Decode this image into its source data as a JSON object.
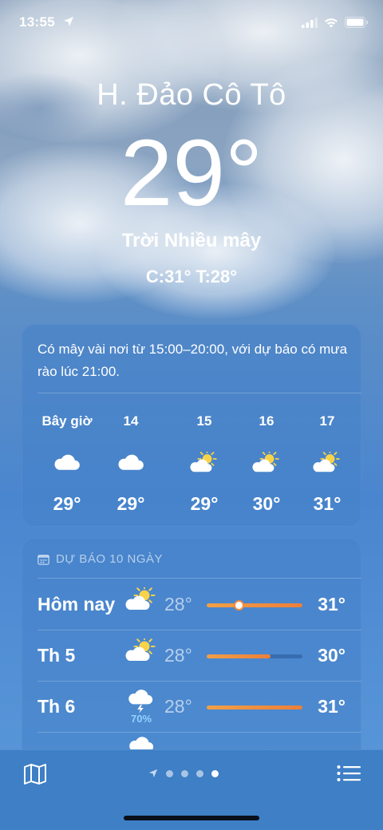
{
  "status_bar": {
    "time": "13:55"
  },
  "location": {
    "name": "H. Đảo Cô Tô",
    "temperature": "29°",
    "condition": "Trời Nhiều mây",
    "high_low": "C:31°  T:28°"
  },
  "hourly": {
    "summary": "Có mây vài nơi từ 15:00–20:00, với dự báo có mưa rào lúc 21:00.",
    "items": [
      {
        "label": "Bây giờ",
        "icon": "cloud-icon",
        "temp": "29°"
      },
      {
        "label": "14",
        "icon": "cloud-icon",
        "temp": "29°"
      },
      {
        "label": "15",
        "icon": "partly-sunny-icon",
        "temp": "29°"
      },
      {
        "label": "16",
        "icon": "partly-sunny-icon",
        "temp": "30°"
      },
      {
        "label": "17",
        "icon": "partly-sunny-icon",
        "temp": "31°"
      }
    ]
  },
  "daily": {
    "header": "DỰ BÁO 10 NGÀY",
    "range": [
      28,
      31
    ],
    "items": [
      {
        "day": "Hôm nay",
        "icon": "partly-sunny-icon",
        "precip": "",
        "low": "28°",
        "high": "31°",
        "low_val": 28,
        "high_val": 31,
        "current": 29
      },
      {
        "day": "Th 5",
        "icon": "partly-sunny-icon",
        "precip": "",
        "low": "28°",
        "high": "30°",
        "low_val": 28,
        "high_val": 30
      },
      {
        "day": "Th 6",
        "icon": "thunderstorm-icon",
        "precip": "70%",
        "low": "28°",
        "high": "31°",
        "low_val": 28,
        "high_val": 31
      }
    ]
  },
  "colors": {
    "bar_fill": "#ef8d3f",
    "precip": "#8fd3ff"
  },
  "tabbar": {
    "pages": 4,
    "active_page": 3
  }
}
